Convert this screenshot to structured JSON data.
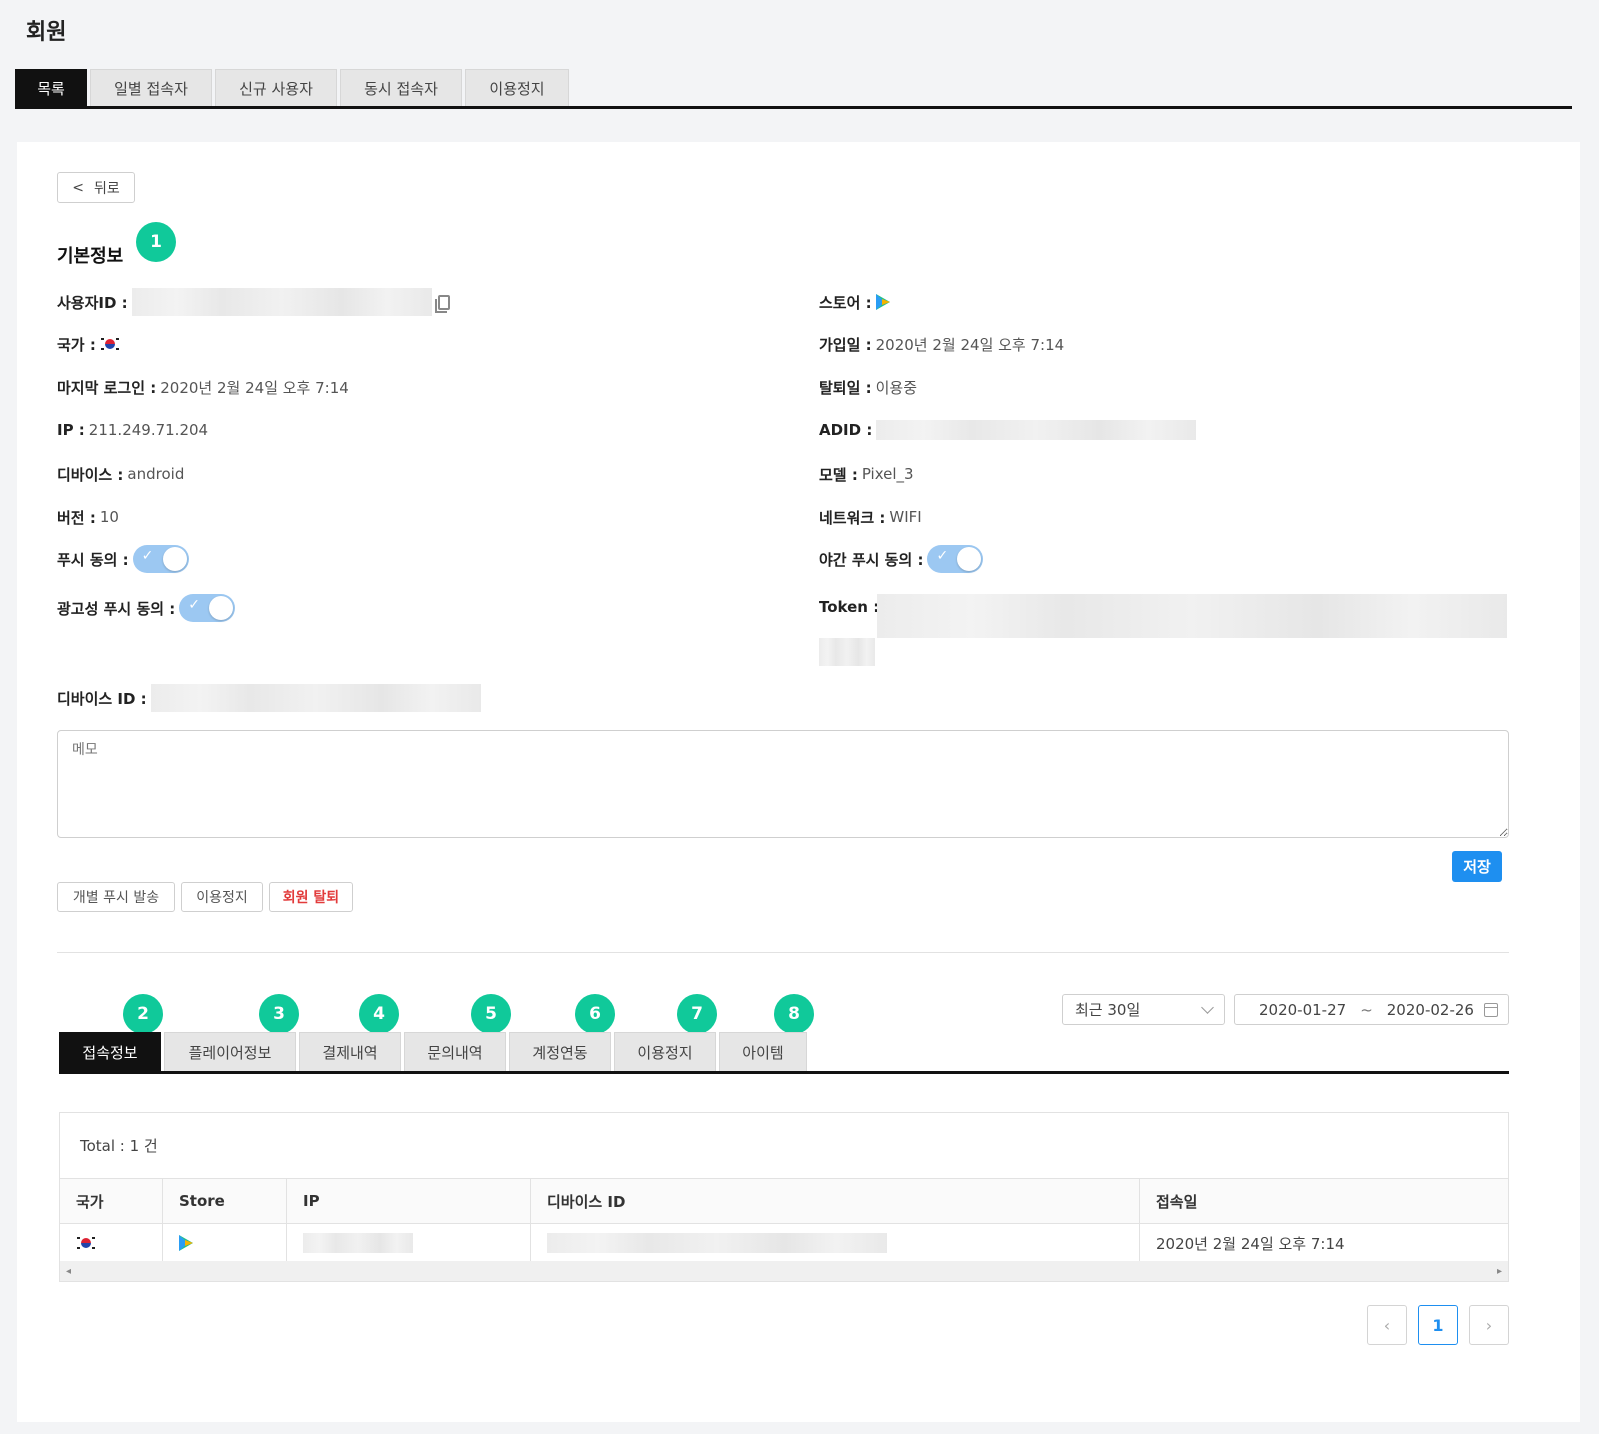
{
  "page": {
    "title": "회원"
  },
  "top_tabs": [
    {
      "label": "목록",
      "active": true
    },
    {
      "label": "일별 접속자"
    },
    {
      "label": "신규 사용자"
    },
    {
      "label": "동시 접속자"
    },
    {
      "label": "이용정지"
    }
  ],
  "back_button": {
    "label": "뒤로"
  },
  "basic_info": {
    "title": "기본정보",
    "badge": "1",
    "left": {
      "user_id_label": "사용자ID :",
      "country_label": "국가 :",
      "last_login_label": "마지막 로그인 :",
      "last_login_value": "2020년 2월 24일 오후 7:14",
      "ip_label": "IP :",
      "ip_value": "211.249.71.204",
      "device_label": "디바이스 :",
      "device_value": "android",
      "version_label": "버전 :",
      "version_value": "10",
      "push_label": "푸시 동의 :",
      "ad_push_label": "광고성 푸시 동의 :",
      "device_id_label": "디바이스 ID :"
    },
    "right": {
      "store_label": "스토어 :",
      "join_label": "가입일 :",
      "join_value": "2020년 2월 24일 오후 7:14",
      "leave_label": "탈퇴일 :",
      "leave_value": "이용중",
      "adid_label": "ADID :",
      "model_label": "모델 :",
      "model_value": "Pixel_3",
      "network_label": "네트워크 :",
      "network_value": "WIFI",
      "night_push_label": "야간 푸시 동의 :",
      "token_label": "Token :"
    },
    "toggles": {
      "push": true,
      "ad_push": true,
      "night_push": true
    }
  },
  "memo": {
    "placeholder": "메모"
  },
  "save_button": {
    "label": "저장"
  },
  "actions": {
    "individual_push": "개별 푸시 발송",
    "suspend": "이용정지",
    "withdraw": "회원 탈퇴"
  },
  "sub_tabs": [
    {
      "label": "접속정보",
      "badge": "2",
      "active": true
    },
    {
      "label": "플레이어정보",
      "badge": "3"
    },
    {
      "label": "결제내역",
      "badge": "4"
    },
    {
      "label": "문의내역",
      "badge": "5"
    },
    {
      "label": "계정연동",
      "badge": "6"
    },
    {
      "label": "이용정지",
      "badge": "7"
    },
    {
      "label": "아이템",
      "badge": "8"
    }
  ],
  "filter": {
    "range": "최근 30일",
    "date_from": "2020-01-27",
    "tilde": "~",
    "date_to": "2020-02-26"
  },
  "table": {
    "total": "Total : 1 건",
    "columns": [
      "국가",
      "Store",
      "IP",
      "디바이스 ID",
      "접속일"
    ],
    "rows": [
      {
        "accessed_at": "2020년 2월 24일 오후 7:14"
      }
    ]
  },
  "pagination": {
    "prev": "‹",
    "current": "1",
    "next": "›"
  },
  "colors": {
    "accent": "#1e8ff0",
    "badge": "#10c99a",
    "danger": "#e23b3b",
    "toggle_on": "#9cc8f2"
  }
}
